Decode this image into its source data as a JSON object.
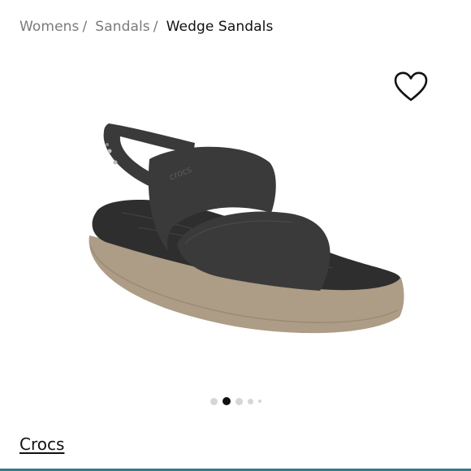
{
  "breadcrumb": {
    "items": [
      {
        "label": "Womens",
        "separator": "/"
      },
      {
        "label": "Sandals",
        "separator": "/"
      }
    ],
    "current": "Wedge Sandals"
  },
  "product": {
    "image_logo_text": "crocs",
    "brand": "Crocs",
    "wishlist_icon": "heart-outline-icon"
  },
  "carousel": {
    "count": 5,
    "active_index": 1
  },
  "colors": {
    "breadcrumb_muted": "#7a7a7a",
    "text": "#111111",
    "active_dot": "#111111",
    "inactive_dot": "#d6d6d6",
    "bottom_rule": "#2f7f8a"
  }
}
